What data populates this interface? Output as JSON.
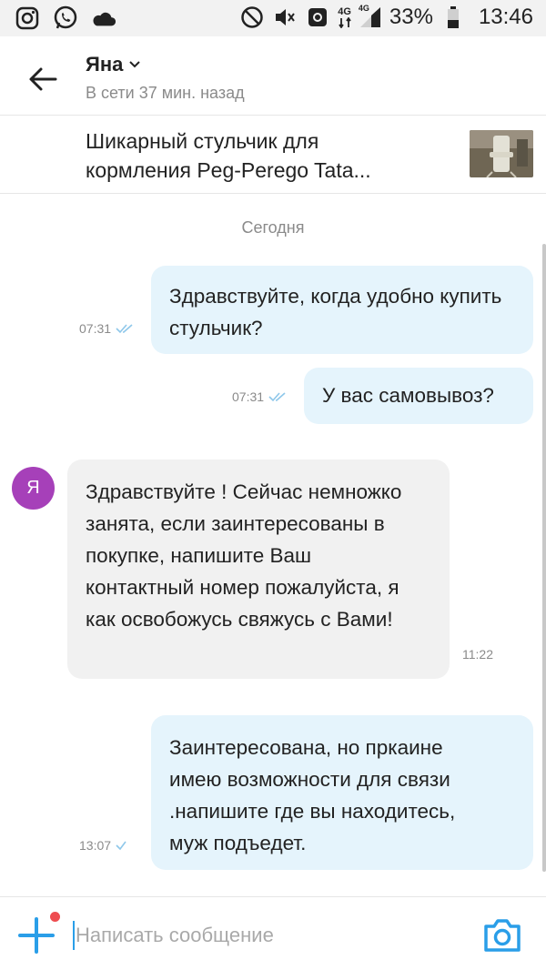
{
  "status_bar": {
    "battery": "33%",
    "time": "13:46",
    "network_a": "4G",
    "network_b": "4G"
  },
  "header": {
    "name": "Яна",
    "status": "В сети 37 мин. назад"
  },
  "item": {
    "title": "Шикарный стульчик для кормления Peg-Perego Tata..."
  },
  "chat": {
    "date_divider": "Сегодня",
    "avatar_letter": "Я",
    "messages": [
      {
        "from": "me",
        "text": "Здравствуйте, когда удобно купить стульчик?",
        "time": "07:31",
        "status": "read"
      },
      {
        "from": "me",
        "text": "У вас самовывоз?",
        "time": "07:31",
        "status": "read"
      },
      {
        "from": "them",
        "text": "Здравствуйте ! Сейчас немножко занята, если заинтересованы в покупке, напишите Ваш контактный номер пожалуйста, я как освобожусь свяжусь с Вами!",
        "time": "11:22"
      },
      {
        "from": "me",
        "text": "Заинтересована, но пркаине имею возможности для связи .напишите где вы находитесь, муж подъедет.",
        "time": "13:07",
        "status": "sent"
      }
    ]
  },
  "composer": {
    "placeholder": "Написать сообщение",
    "value": ""
  },
  "colors": {
    "accent": "#2a9ee8",
    "outgoing_bubble": "#e5f4fc",
    "incoming_bubble": "#f1f1f1",
    "avatar": "#a640b9",
    "notification_dot": "#ee4c50"
  }
}
